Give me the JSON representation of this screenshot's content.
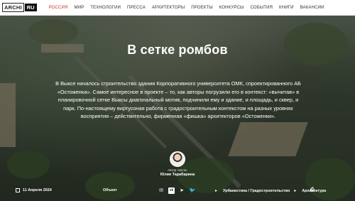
{
  "header": {
    "logo_left": "ARCHI",
    "logo_right": "RU",
    "nav": [
      {
        "label": "РОССИЯ",
        "active": true
      },
      {
        "label": "МИР",
        "active": false
      },
      {
        "label": "ТЕХНОЛОГИИ",
        "active": false
      },
      {
        "label": "ПРЕССА",
        "active": false
      },
      {
        "label": "АРХИТЕКТОРЫ",
        "active": false
      },
      {
        "label": "ПРОЕКТЫ",
        "active": false
      },
      {
        "label": "КОНКУРСЫ",
        "active": false
      },
      {
        "label": "СОБЫТИЯ",
        "active": false
      },
      {
        "label": "КНИГИ",
        "active": false
      },
      {
        "label": "ВАКАНСИИ",
        "active": false
      }
    ],
    "accent_color": "#d0302a"
  },
  "article": {
    "title": "В сетке ромбов",
    "lead": "В Выксе началось строительство здания Корпоративного университета ОМК, спроектированного АБ «Остоженка». Самое интересное в проекте – то, как авторы погрузили его в контекст: «вычитав» в планировочной сетке Выксы диагональный мотив, подчинили ему и здание, и площадь, и сквер, и парк. По-настоящему виртуозная работа с градостроительным контекстом на разных уровнях восприятия – действительно, фирменная «фишка» архитекторов «Остоженки».",
    "author_role": "Автор текста:",
    "author_name": "Юлия Тарабарина",
    "date": "11 Апреля 2024",
    "type": "Объект",
    "share_icons": [
      "vk-icon",
      "telegram-icon",
      "twitter-icon"
    ],
    "share_vk_label": "vk",
    "tags": [
      "Урбанистика / Градостроительство",
      "Архитектура"
    ]
  }
}
